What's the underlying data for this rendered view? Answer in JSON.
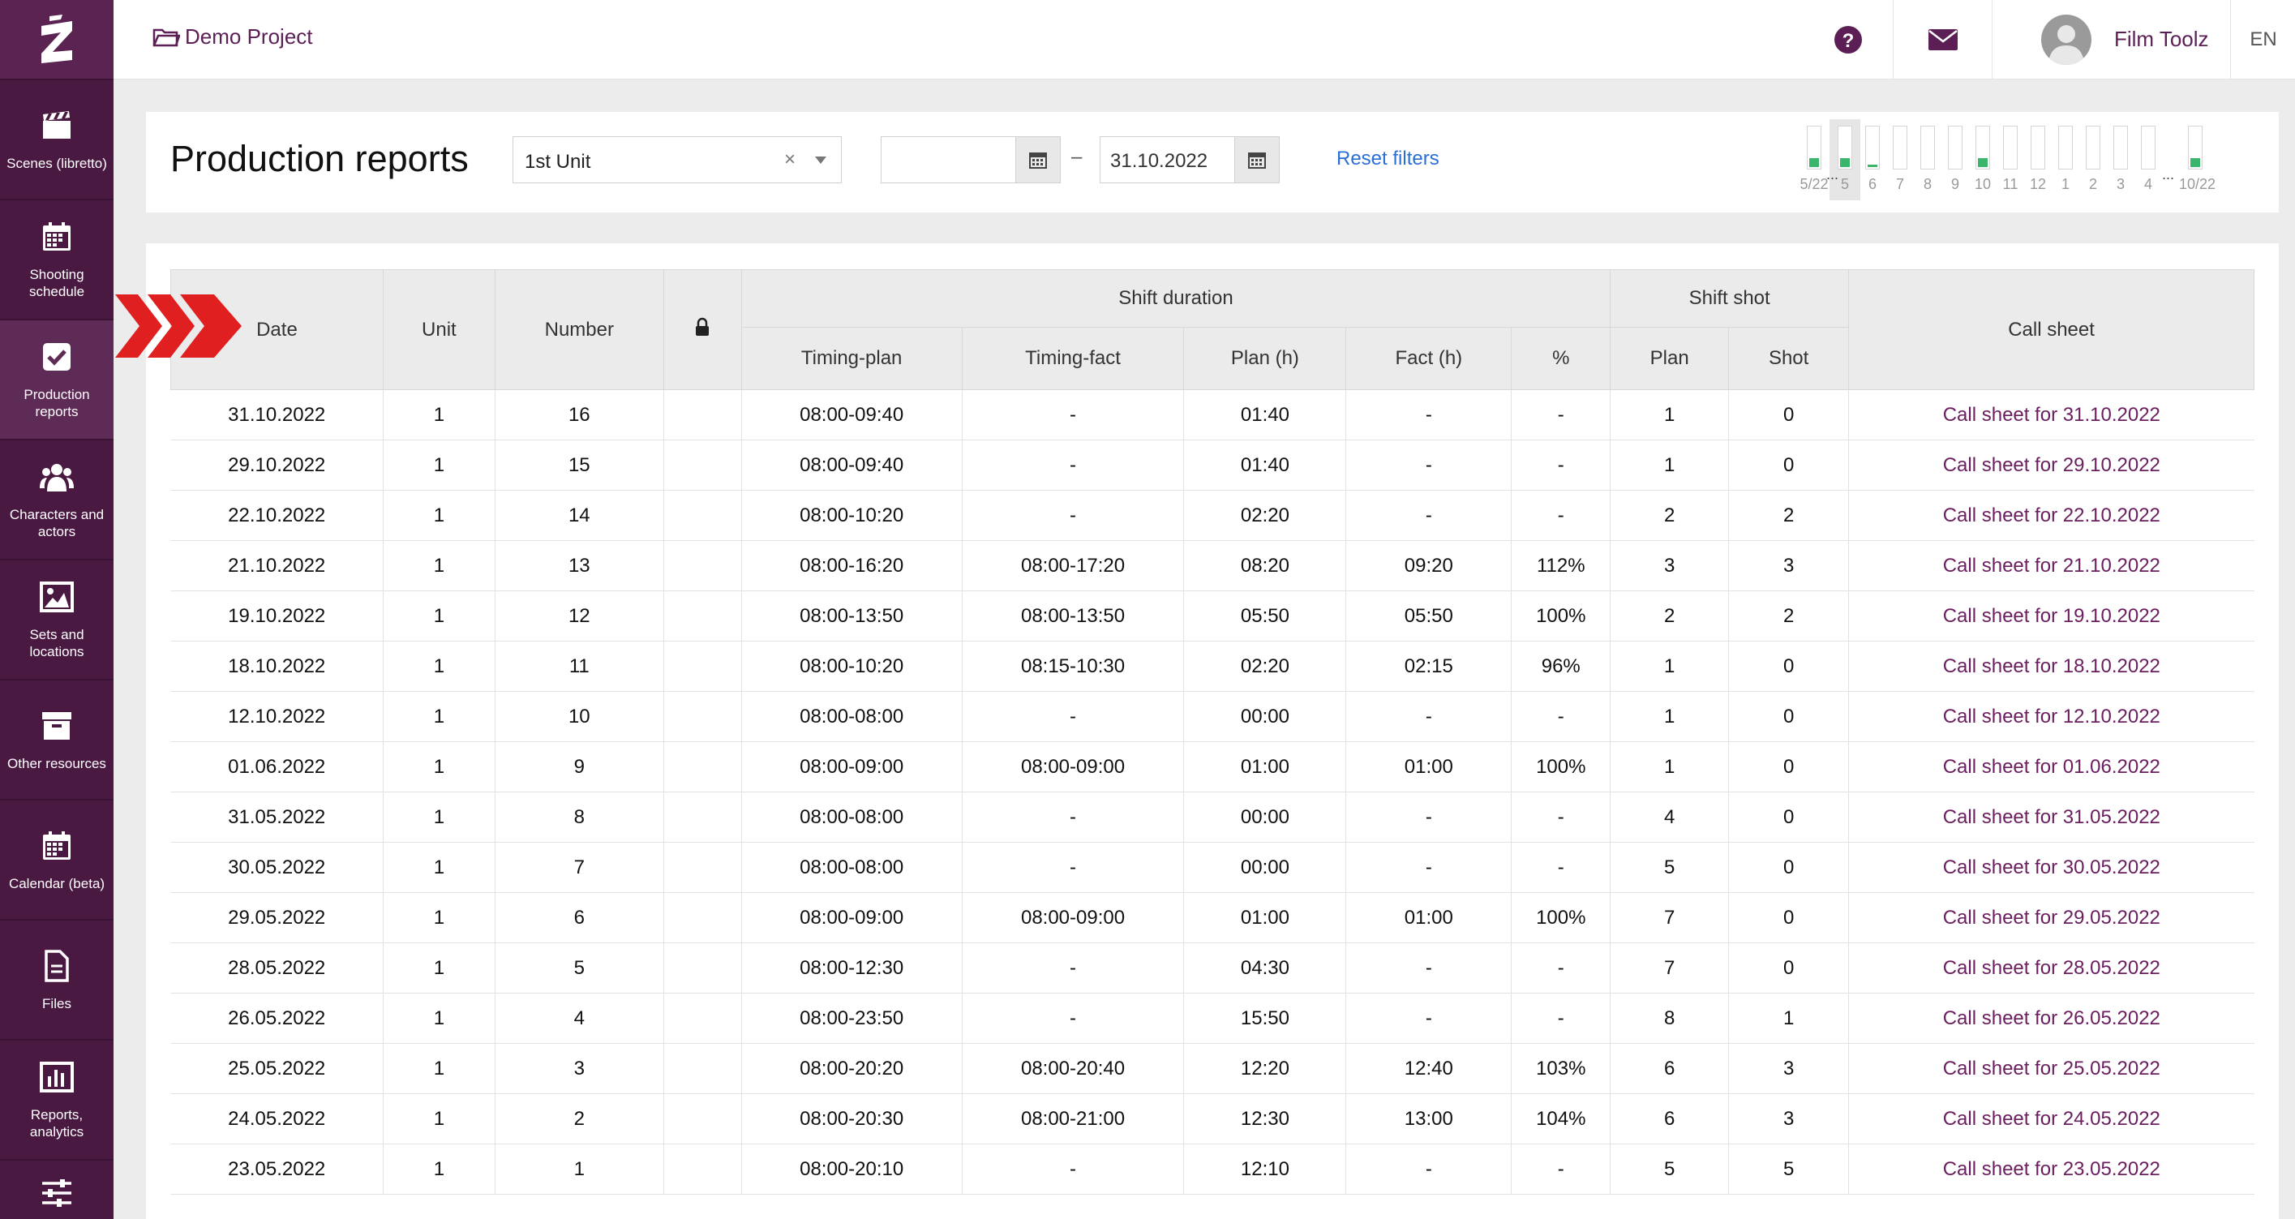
{
  "nav": {
    "items": [
      {
        "label": "Scenes (libretto)",
        "icon": "clapperboard-icon"
      },
      {
        "label": "Shooting schedule",
        "icon": "calendar-icon"
      },
      {
        "label": "Production reports",
        "icon": "checkbox-icon",
        "active": true
      },
      {
        "label": "Characters and actors",
        "icon": "people-icon"
      },
      {
        "label": "Sets and locations",
        "icon": "image-icon"
      },
      {
        "label": "Other resources",
        "icon": "archive-box-icon"
      },
      {
        "label": "Calendar (beta)",
        "icon": "calendar-grid-icon"
      },
      {
        "label": "Files",
        "icon": "file-icon"
      },
      {
        "label": "Reports, analytics",
        "icon": "bar-chart-icon"
      },
      {
        "label": "",
        "icon": "sliders-icon"
      }
    ]
  },
  "topbar": {
    "project": "Demo Project",
    "user": "Film Toolz",
    "lang": "EN"
  },
  "header": {
    "title": "Production reports",
    "unit_value": "1st Unit",
    "clear_symbol": "×",
    "date_from": "",
    "date_to": "31.10.2022",
    "date_separator": "–",
    "reset_label": "Reset filters"
  },
  "mini_calendar": {
    "labels": [
      "5/22",
      "5",
      "6",
      "7",
      "8",
      "9",
      "10",
      "11",
      "12",
      "1",
      "2",
      "3",
      "4",
      "10/22"
    ],
    "fill_fraction": [
      0.22,
      0.22,
      0.05,
      0,
      0,
      0,
      0.22,
      0,
      0,
      0,
      0,
      0,
      0,
      0.22
    ],
    "ellipsis": "...",
    "fill_color": "#3ab56b"
  },
  "table": {
    "headers": {
      "date": "Date",
      "unit": "Unit",
      "number": "Number",
      "shift_duration": "Shift duration",
      "shift_shot": "Shift shot",
      "call_sheet": "Call sheet",
      "timing_plan": "Timing-plan",
      "timing_fact": "Timing-fact",
      "plan_h": "Plan (h)",
      "fact_h": "Fact (h)",
      "percent": "%",
      "plan": "Plan",
      "shot": "Shot"
    },
    "rows": [
      {
        "date": "31.10.2022",
        "unit": "1",
        "number": "16",
        "timing_plan": "08:00-09:40",
        "timing_fact": "-",
        "plan_h": "01:40",
        "fact_h": "-",
        "percent": "-",
        "plan": "1",
        "shot": "0",
        "call_sheet": "Call sheet for 31.10.2022"
      },
      {
        "date": "29.10.2022",
        "unit": "1",
        "number": "15",
        "timing_plan": "08:00-09:40",
        "timing_fact": "-",
        "plan_h": "01:40",
        "fact_h": "-",
        "percent": "-",
        "plan": "1",
        "shot": "0",
        "call_sheet": "Call sheet for 29.10.2022"
      },
      {
        "date": "22.10.2022",
        "unit": "1",
        "number": "14",
        "timing_plan": "08:00-10:20",
        "timing_fact": "-",
        "plan_h": "02:20",
        "fact_h": "-",
        "percent": "-",
        "plan": "2",
        "shot": "2",
        "call_sheet": "Call sheet for 22.10.2022"
      },
      {
        "date": "21.10.2022",
        "unit": "1",
        "number": "13",
        "timing_plan": "08:00-16:20",
        "timing_fact": "08:00-17:20",
        "plan_h": "08:20",
        "fact_h": "09:20",
        "percent": "112%",
        "plan": "3",
        "shot": "3",
        "call_sheet": "Call sheet for 21.10.2022"
      },
      {
        "date": "19.10.2022",
        "unit": "1",
        "number": "12",
        "timing_plan": "08:00-13:50",
        "timing_fact": "08:00-13:50",
        "plan_h": "05:50",
        "fact_h": "05:50",
        "percent": "100%",
        "plan": "2",
        "shot": "2",
        "call_sheet": "Call sheet for 19.10.2022"
      },
      {
        "date": "18.10.2022",
        "unit": "1",
        "number": "11",
        "timing_plan": "08:00-10:20",
        "timing_fact": "08:15-10:30",
        "plan_h": "02:20",
        "fact_h": "02:15",
        "percent": "96%",
        "plan": "1",
        "shot": "0",
        "call_sheet": "Call sheet for 18.10.2022"
      },
      {
        "date": "12.10.2022",
        "unit": "1",
        "number": "10",
        "timing_plan": "08:00-08:00",
        "timing_fact": "-",
        "plan_h": "00:00",
        "fact_h": "-",
        "percent": "-",
        "plan": "1",
        "shot": "0",
        "call_sheet": "Call sheet for 12.10.2022"
      },
      {
        "date": "01.06.2022",
        "unit": "1",
        "number": "9",
        "timing_plan": "08:00-09:00",
        "timing_fact": "08:00-09:00",
        "plan_h": "01:00",
        "fact_h": "01:00",
        "percent": "100%",
        "plan": "1",
        "shot": "0",
        "call_sheet": "Call sheet for 01.06.2022"
      },
      {
        "date": "31.05.2022",
        "unit": "1",
        "number": "8",
        "timing_plan": "08:00-08:00",
        "timing_fact": "-",
        "plan_h": "00:00",
        "fact_h": "-",
        "percent": "-",
        "plan": "4",
        "shot": "0",
        "call_sheet": "Call sheet for 31.05.2022"
      },
      {
        "date": "30.05.2022",
        "unit": "1",
        "number": "7",
        "timing_plan": "08:00-08:00",
        "timing_fact": "-",
        "plan_h": "00:00",
        "fact_h": "-",
        "percent": "-",
        "plan": "5",
        "shot": "0",
        "call_sheet": "Call sheet for 30.05.2022"
      },
      {
        "date": "29.05.2022",
        "unit": "1",
        "number": "6",
        "timing_plan": "08:00-09:00",
        "timing_fact": "08:00-09:00",
        "plan_h": "01:00",
        "fact_h": "01:00",
        "percent": "100%",
        "plan": "7",
        "shot": "0",
        "call_sheet": "Call sheet for 29.05.2022"
      },
      {
        "date": "28.05.2022",
        "unit": "1",
        "number": "5",
        "timing_plan": "08:00-12:30",
        "timing_fact": "-",
        "plan_h": "04:30",
        "fact_h": "-",
        "percent": "-",
        "plan": "7",
        "shot": "0",
        "call_sheet": "Call sheet for 28.05.2022"
      },
      {
        "date": "26.05.2022",
        "unit": "1",
        "number": "4",
        "timing_plan": "08:00-23:50",
        "timing_fact": "-",
        "plan_h": "15:50",
        "fact_h": "-",
        "percent": "-",
        "plan": "8",
        "shot": "1",
        "call_sheet": "Call sheet for 26.05.2022"
      },
      {
        "date": "25.05.2022",
        "unit": "1",
        "number": "3",
        "timing_plan": "08:00-20:20",
        "timing_fact": "08:00-20:40",
        "plan_h": "12:20",
        "fact_h": "12:40",
        "percent": "103%",
        "plan": "6",
        "shot": "3",
        "call_sheet": "Call sheet for 25.05.2022"
      },
      {
        "date": "24.05.2022",
        "unit": "1",
        "number": "2",
        "timing_plan": "08:00-20:30",
        "timing_fact": "08:00-21:00",
        "plan_h": "12:30",
        "fact_h": "13:00",
        "percent": "104%",
        "plan": "6",
        "shot": "3",
        "call_sheet": "Call sheet for 24.05.2022"
      },
      {
        "date": "23.05.2022",
        "unit": "1",
        "number": "1",
        "timing_plan": "08:00-20:10",
        "timing_fact": "-",
        "plan_h": "12:10",
        "fact_h": "-",
        "percent": "-",
        "plan": "5",
        "shot": "5",
        "call_sheet": "Call sheet for 23.05.2022"
      }
    ]
  }
}
